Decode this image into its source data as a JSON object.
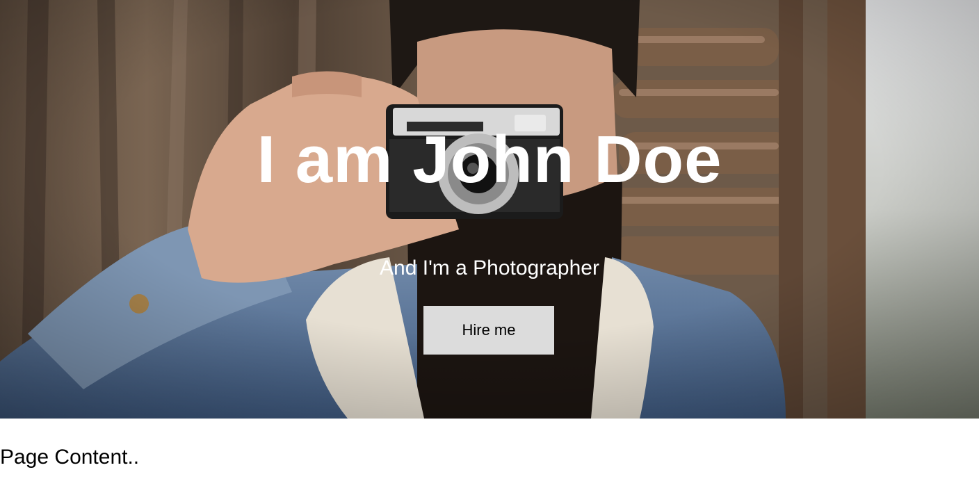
{
  "hero": {
    "title": "I am John Doe",
    "subtitle": "And I'm a Photographer",
    "button_label": "Hire me"
  },
  "main": {
    "content_text": "Page Content.."
  },
  "colors": {
    "button_background": "#dcdcdc",
    "hero_text": "#ffffff",
    "page_background": "#ffffff"
  }
}
